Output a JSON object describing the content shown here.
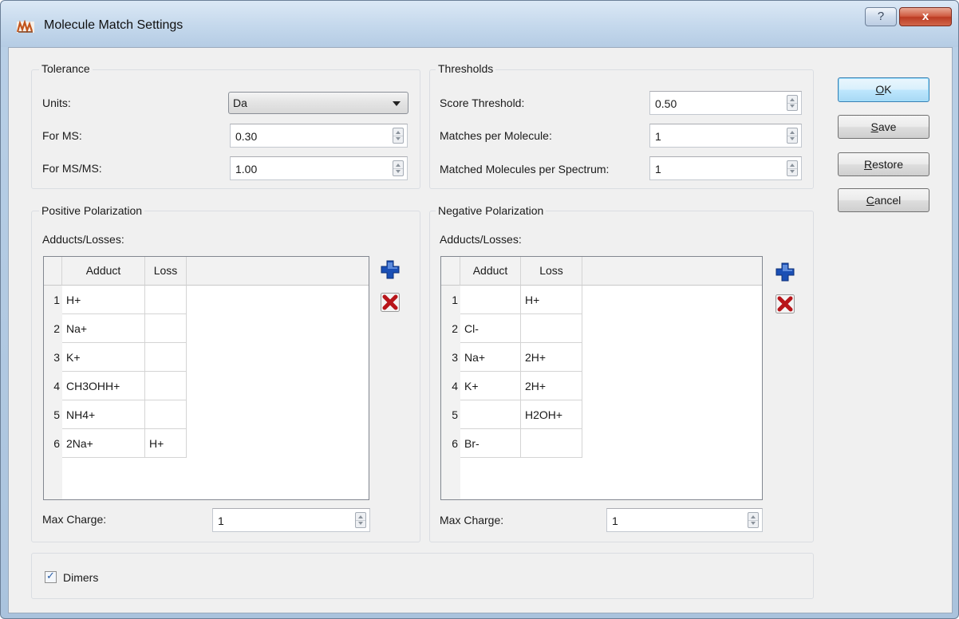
{
  "window": {
    "title": "Molecule Match Settings",
    "help_glyph": "?",
    "close_glyph": "x"
  },
  "tolerance": {
    "title": "Tolerance",
    "units_label": "Units:",
    "units_value": "Da",
    "ms_label": "For MS:",
    "ms_value": "0.30",
    "msms_label": "For MS/MS:",
    "msms_value": "1.00"
  },
  "thresholds": {
    "title": "Thresholds",
    "score_label": "Score Threshold:",
    "score_value": "0.50",
    "matches_label": "Matches per Molecule:",
    "matches_value": "1",
    "matched_molecules_label": "Matched Molecules per Spectrum:",
    "matched_molecules_value": "1"
  },
  "positive": {
    "title": "Positive Polarization",
    "adducts_label": "Adducts/Losses:",
    "columns": [
      "Adduct",
      "Loss"
    ],
    "rows": [
      {
        "n": "1",
        "adduct": "H+",
        "loss": ""
      },
      {
        "n": "2",
        "adduct": "Na+",
        "loss": ""
      },
      {
        "n": "3",
        "adduct": "K+",
        "loss": ""
      },
      {
        "n": "4",
        "adduct": "CH3OHH+",
        "loss": ""
      },
      {
        "n": "5",
        "adduct": "NH4+",
        "loss": ""
      },
      {
        "n": "6",
        "adduct": "2Na+",
        "loss": "H+"
      }
    ],
    "max_charge_label": "Max Charge:",
    "max_charge_value": "1"
  },
  "negative": {
    "title": "Negative Polarization",
    "adducts_label": "Adducts/Losses:",
    "columns": [
      "Adduct",
      "Loss"
    ],
    "rows": [
      {
        "n": "1",
        "adduct": "",
        "loss": "H+"
      },
      {
        "n": "2",
        "adduct": "Cl-",
        "loss": ""
      },
      {
        "n": "3",
        "adduct": "Na+",
        "loss": "2H+"
      },
      {
        "n": "4",
        "adduct": "K+",
        "loss": "2H+"
      },
      {
        "n": "5",
        "adduct": "",
        "loss": "H2OH+"
      },
      {
        "n": "6",
        "adduct": "Br-",
        "loss": ""
      }
    ],
    "max_charge_label": "Max Charge:",
    "max_charge_value": "1"
  },
  "dimers": {
    "label": "Dimers",
    "checked": true
  },
  "buttons": {
    "ok_mnemonic": "O",
    "ok_rest": "K",
    "save_mnemonic": "S",
    "save_rest": "ave",
    "restore_mnemonic": "R",
    "restore_rest": "estore",
    "cancel_mnemonic": "C",
    "cancel_rest": "ancel"
  },
  "icons": {
    "add": "plus-icon",
    "remove": "x-icon",
    "app": "app-icon"
  },
  "colors": {
    "add_icon": "#1a4fb5",
    "remove_icon": "#b8151a",
    "default_button_border": "#3c7fb1"
  }
}
